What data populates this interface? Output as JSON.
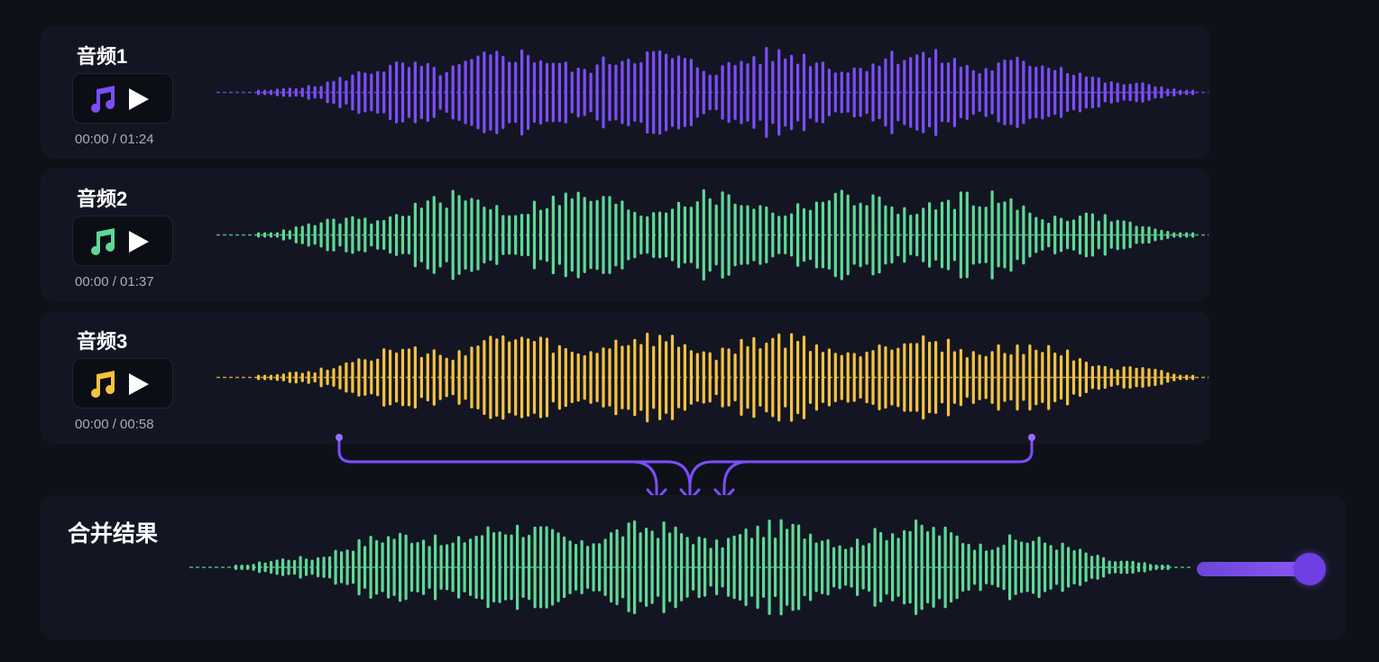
{
  "colors": {
    "background": "#0f1118",
    "panel": "#131622",
    "connector": "#7c4dff"
  },
  "tracks": [
    {
      "label": "音频1",
      "time": "00:00 / 01:24",
      "color": "#7c4dff",
      "note_icon": "music-note-icon",
      "play_icon": "play-icon"
    },
    {
      "label": "音频2",
      "time": "00:00 / 01:37",
      "color": "#5fd896",
      "note_icon": "music-note-icon",
      "play_icon": "play-icon"
    },
    {
      "label": "音频3",
      "time": "00:00 / 00:58",
      "color": "#f5c242",
      "note_icon": "music-note-icon",
      "play_icon": "play-icon"
    }
  ],
  "result": {
    "title": "合并结果",
    "color": "#5fd896",
    "slider_value": 1.0
  },
  "icons": {
    "connector": "merge-arrows-icon"
  }
}
